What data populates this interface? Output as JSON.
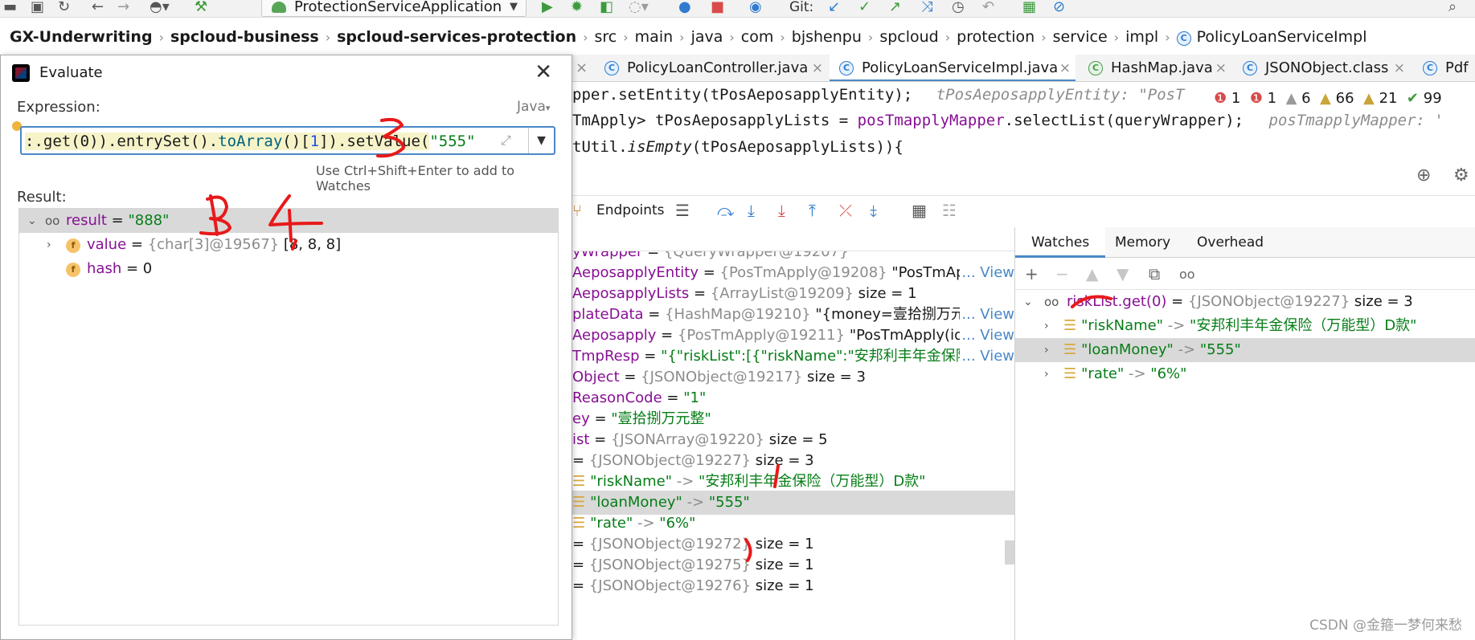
{
  "toolbar": {
    "run_config": "ProtectionServiceApplication",
    "git_label": "Git:"
  },
  "breadcrumb": [
    {
      "label": "GX-Underwriting",
      "bold": true
    },
    {
      "label": "spcloud-business",
      "bold": true
    },
    {
      "label": "spcloud-services-protection",
      "bold": true
    },
    {
      "label": "src"
    },
    {
      "label": "main"
    },
    {
      "label": "java"
    },
    {
      "label": "com"
    },
    {
      "label": "bjshenpu"
    },
    {
      "label": "spcloud"
    },
    {
      "label": "protection"
    },
    {
      "label": "service"
    },
    {
      "label": "impl"
    },
    {
      "label": "PolicyLoanServiceImpl",
      "badge": "C"
    }
  ],
  "editor_tabs": [
    {
      "label": "PolicyLoanController.java",
      "badge": "C",
      "close": "×"
    },
    {
      "label": "PolicyLoanServiceImpl.java",
      "badge": "C",
      "close": "×",
      "active": true
    },
    {
      "label": "HashMap.java",
      "badge": "C",
      "close": "×"
    },
    {
      "label": "JSONObject.class",
      "badge": "C",
      "close": "×"
    },
    {
      "label": "Pdf",
      "badge": "C"
    }
  ],
  "code": {
    "line1_a": "pper.setEntity(tPosAeposapplyEntity);",
    "line1_hint": "tPosAeposapplyEntity: \"PosT",
    "line2_a": "TmApply>",
    "line2_b": " tPosAeposapplyLists = ",
    "line2_c": "posTmapplyMapper",
    "line2_d": ".selectList(queryWrapper);",
    "line2_hint": "posTmapplyMapper: '",
    "line3_a": "tUtil.",
    "line3_b": "isEmpty",
    "line3_c": "(tPosAeposapplyLists)){"
  },
  "inspections": {
    "errors1": "1",
    "errors2": "1",
    "weak": "6",
    "warnings": "66",
    "typos": "21",
    "ok": "99"
  },
  "debug": {
    "endpoints_label": "Endpoints"
  },
  "variables": [
    {
      "name": "yWrapper",
      "eq": " = ",
      "type": "{QueryWrapper@19207}",
      "cut": true
    },
    {
      "name": "AeposapplyEntity",
      "eq": " = ",
      "type": "{PosTmApply@19208}",
      "value": " \"PosTmApply",
      "view": "... View"
    },
    {
      "name": "AeposapplyLists",
      "eq": " = ",
      "type": "{ArrayList@19209}",
      "value": "  size = 1"
    },
    {
      "name": "plateData",
      "eq": " = ",
      "type": "{HashMap@19210}",
      "value": " \"{money=壹拾捌万元整, r",
      "view": "... View"
    },
    {
      "name": "Aeposapply",
      "eq": " = ",
      "type": "{PosTmApply@19211}",
      "value": " \"PosTmApply(id=1",
      "view": "... View"
    },
    {
      "name": "TmpResp",
      "eq": " = ",
      "str": "\"{\"riskList\":[{\"riskName\":\"安邦利丰年金保险（万",
      "view": "... View"
    },
    {
      "name": "Object",
      "eq": " = ",
      "type": "{JSONObject@19217}",
      "value": "  size = 3"
    },
    {
      "name": "ReasonCode",
      "eq": " = ",
      "str": "\"1\""
    },
    {
      "name": "ey",
      "eq": " = ",
      "str": "\"壹拾捌万元整\""
    },
    {
      "name": "ist",
      "eq": " = ",
      "type": "{JSONArray@19220}",
      "value": "  size = 5"
    },
    {
      "name": "",
      "eq": " = ",
      "type": "{JSONObject@19227}",
      "value": "  size = 3"
    },
    {
      "key": "\"riskName\"",
      "arrow": " -> ",
      "str": "\"安邦利丰年金保险（万能型）D款\""
    },
    {
      "key": "\"loanMoney\"",
      "arrow": " -> ",
      "str": "\"555\"",
      "selected": true
    },
    {
      "key": "\"rate\"",
      "arrow": " -> ",
      "str": "\"6%\""
    },
    {
      "name": "",
      "eq": " = ",
      "type": "{JSONObject@19272}",
      "value": "  size = 1"
    },
    {
      "name": "",
      "eq": " = ",
      "type": "{JSONObject@19275}",
      "value": "  size = 1"
    },
    {
      "name": "",
      "eq": " = ",
      "type": "{JSONObject@19276}",
      "value": "  size = 1"
    }
  ],
  "watches_panel": {
    "tabs": [
      "Watches",
      "Memory",
      "Overhead"
    ],
    "root": {
      "name": "riskList.get(0)",
      "eq": " = ",
      "type": "{JSONObject@19227}",
      "value": "  size = 3"
    },
    "entries": [
      {
        "key": "\"riskName\"",
        "arrow": " -> ",
        "str": "\"安邦利丰年金保险（万能型）D款\""
      },
      {
        "key": "\"loanMoney\"",
        "arrow": " -> ",
        "str": "\"555\"",
        "selected": true
      },
      {
        "key": "\"rate\"",
        "arrow": " -> ",
        "str": "\"6%\""
      }
    ]
  },
  "evaluate": {
    "title": "Evaluate",
    "close": "✕",
    "expression_label": "Expression:",
    "language": "Java",
    "expr_part1": ":.get(0)).entrySet().",
    "expr_fn": "toArray",
    "expr_part2": "()[",
    "expr_num": "1",
    "expr_part3": "]).setValue(",
    "expr_str": "\"555\"",
    "watch_hint": "Use Ctrl+Shift+Enter to add to Watches",
    "result_label": "Result:",
    "result": {
      "name": "result",
      "eq": " = ",
      "str": "\"888\""
    },
    "fields": [
      {
        "name": "value",
        "eq": " = ",
        "type": "{char[3]@19567}",
        "value": " [8, 8, 8]"
      },
      {
        "name": "hash",
        "eq": " = ",
        "value": "0"
      }
    ]
  },
  "watermark": "CSDN @金箍一梦何来愁",
  "colors": {
    "accent": "#4a88c7",
    "string": "#067d17",
    "field": "#871094",
    "annotation": "#e8191a"
  }
}
